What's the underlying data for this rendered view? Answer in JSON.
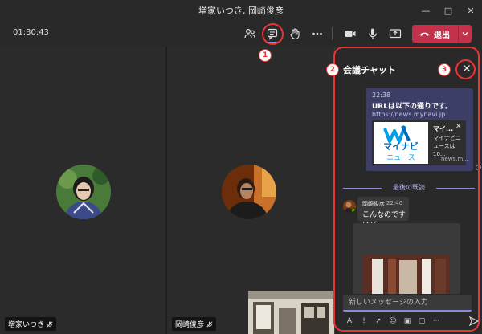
{
  "window": {
    "title": "増家いつき, 岡崎俊彦",
    "controls": [
      "minimize",
      "maximize",
      "close"
    ]
  },
  "toolbar": {
    "timer": "01:30:43",
    "buttons": [
      "people-icon",
      "chat-icon",
      "raise-hand-icon",
      "more-icon",
      "camera-icon",
      "mic-icon",
      "share-icon"
    ],
    "leave_label": "退出"
  },
  "stage": {
    "participants": [
      {
        "name": "増家いつき"
      },
      {
        "name": "岡崎俊彦"
      }
    ]
  },
  "chat": {
    "title": "会議チャット",
    "messages": [
      {
        "time": "22:38",
        "text": "URLは以下の通りです。",
        "link": "https://news.mynavi.jp",
        "preview": {
          "logo_text": "マイナビ",
          "logo_sub": "ニュース",
          "title": "マイ...",
          "desc": "マイナビニュースは10...",
          "domain": "news.m..."
        }
      },
      {
        "author": "岡崎俊彦",
        "time": "22:40",
        "text": "こんなのですけど"
      }
    ],
    "last_read_label": "最後の既読",
    "compose_placeholder": "新しいメッセージの入力"
  },
  "annotations": {
    "one": "1",
    "two": "2",
    "three": "3"
  },
  "colors": {
    "accent": "#8b8cd9",
    "leave": "#c4314b",
    "annotation": "#e33333",
    "bubble_self": "#3d3e66"
  }
}
